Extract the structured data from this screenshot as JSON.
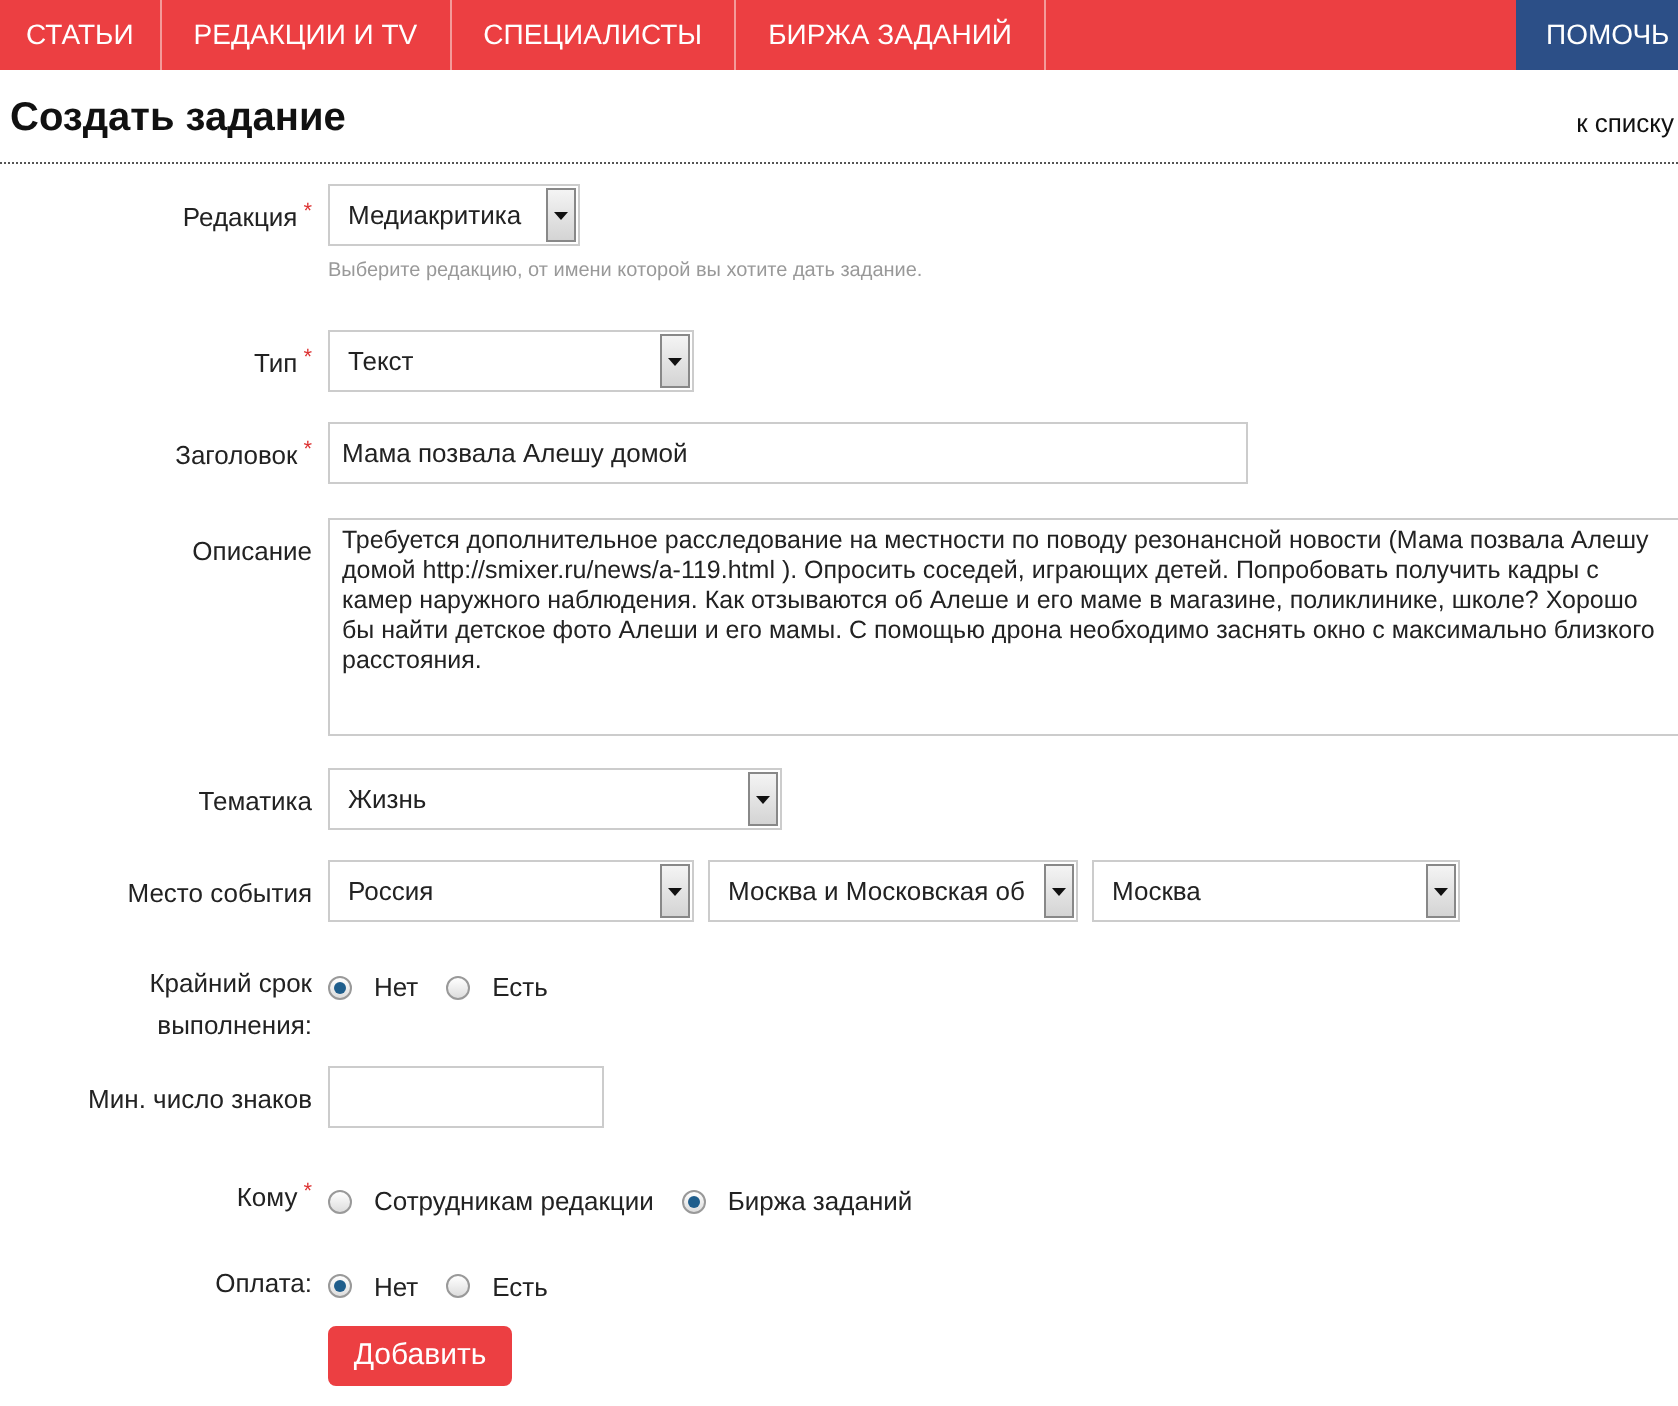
{
  "nav": {
    "items": [
      {
        "label": "СТАТЬИ",
        "selected": false
      },
      {
        "label": "РЕДАКЦИИ И TV",
        "selected": false
      },
      {
        "label": "СПЕЦИАЛИСТЫ",
        "selected": false
      },
      {
        "label": "БИРЖА ЗАДАНИЙ",
        "selected": false
      }
    ],
    "help": "ПОМОЧЬ"
  },
  "page": {
    "title": "Создать задание",
    "back_link": "к списку"
  },
  "form": {
    "fields": [
      {
        "kind": "select",
        "label": "Редакция",
        "marker": "*",
        "value": "Медиакритика",
        "hint": "Выберите редакцию, от имени которой вы хотите дать задание."
      },
      {
        "kind": "select",
        "label": "Тип",
        "marker": "*",
        "value": "Текст"
      },
      {
        "kind": "text",
        "label": "Заголовок",
        "marker": "*",
        "value": "Мама позвала Алешу домой"
      },
      {
        "kind": "textarea",
        "label": "Описание",
        "value": "Требуется дополнительное расследование на местности по поводу резонансной новости (Мама позвала Алешу домой http://smixer.ru/news/a-119.html ). Опросить соседей, играющих детей. Попробовать получить кадры с камер наружного наблюдения. Как отзываются об Алеше и его маме в магазине, поликлинике, школе? Хорошо бы найти детское фото Алеши и его мамы. С помощью дрона необходимо заснять окно с максимально близкого расстояния."
      },
      {
        "kind": "select",
        "label": "Тематика",
        "value": "Жизнь"
      },
      {
        "kind": "select_group",
        "label": "Место события",
        "values": [
          "Россия",
          "Москва и Московская об",
          "Москва"
        ]
      },
      {
        "kind": "radio",
        "label": "Крайний срок выполнения:",
        "options": [
          {
            "label": "Нет",
            "selected": true
          },
          {
            "label": "Есть",
            "selected": false
          }
        ]
      },
      {
        "kind": "text",
        "label": "Мин. число знаков"
      },
      {
        "kind": "radio",
        "label": "Кому",
        "marker": "*",
        "options": [
          {
            "label": "Сотрудникам редакции",
            "selected": false
          },
          {
            "label": "Биржа заданий",
            "selected": true
          }
        ]
      },
      {
        "kind": "radio",
        "label": "Оплата:",
        "options": [
          {
            "label": "Нет",
            "selected": true
          },
          {
            "label": "Есть",
            "selected": false
          }
        ]
      }
    ],
    "submit": "Добавить"
  }
}
